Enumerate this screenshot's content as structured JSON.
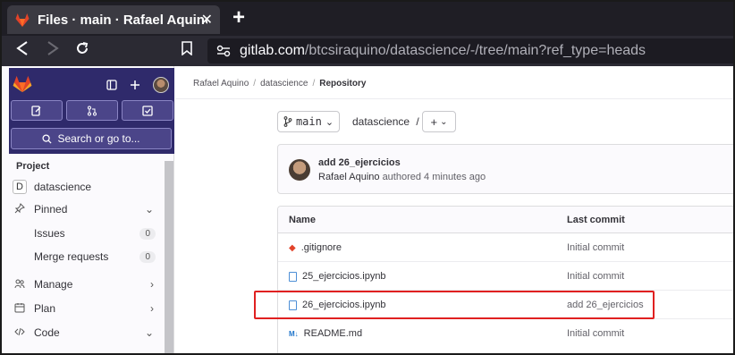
{
  "browser": {
    "tab_title": "Files · main · Rafael Aquino",
    "tab_close": "✕",
    "new_tab": "+",
    "url_host": "gitlab.com",
    "url_path": "/btcsiraquino/datascience/-/tree/main?ref_type=heads"
  },
  "sidebar": {
    "search_label": "Search or go to...",
    "section_title": "Project",
    "project_initial": "D",
    "items": [
      {
        "label": "datascience"
      },
      {
        "label": "Pinned"
      },
      {
        "label": "Issues",
        "count": "0"
      },
      {
        "label": "Merge requests",
        "count": "0"
      },
      {
        "label": "Manage"
      },
      {
        "label": "Plan"
      },
      {
        "label": "Code"
      }
    ]
  },
  "breadcrumb": {
    "items": [
      "Rafael Aquino",
      "datascience",
      "Repository"
    ],
    "separator": "/"
  },
  "repo": {
    "branch": "main",
    "path": "datascience",
    "path_sep": "/",
    "add_label": "+"
  },
  "commit": {
    "title": "add 26_ejercicios",
    "author": "Rafael Aquino",
    "meta": "authored 4 minutes ago"
  },
  "files": {
    "columns": [
      "Name",
      "Last commit"
    ],
    "rows": [
      {
        "name": ".gitignore",
        "last_commit": "Initial commit",
        "icon": "git-icon"
      },
      {
        "name": "25_ejercicios.ipynb",
        "last_commit": "Initial commit",
        "icon": "file-icon"
      },
      {
        "name": "26_ejercicios.ipynb",
        "last_commit": "add 26_ejercicios",
        "icon": "file-icon"
      },
      {
        "name": "README.md",
        "last_commit": "Initial commit",
        "icon": "markdown-icon"
      }
    ]
  },
  "colors": {
    "sidebar_top": "#2f2a6b",
    "highlight": "#e02020",
    "gitlab_orange": "#e24329"
  }
}
